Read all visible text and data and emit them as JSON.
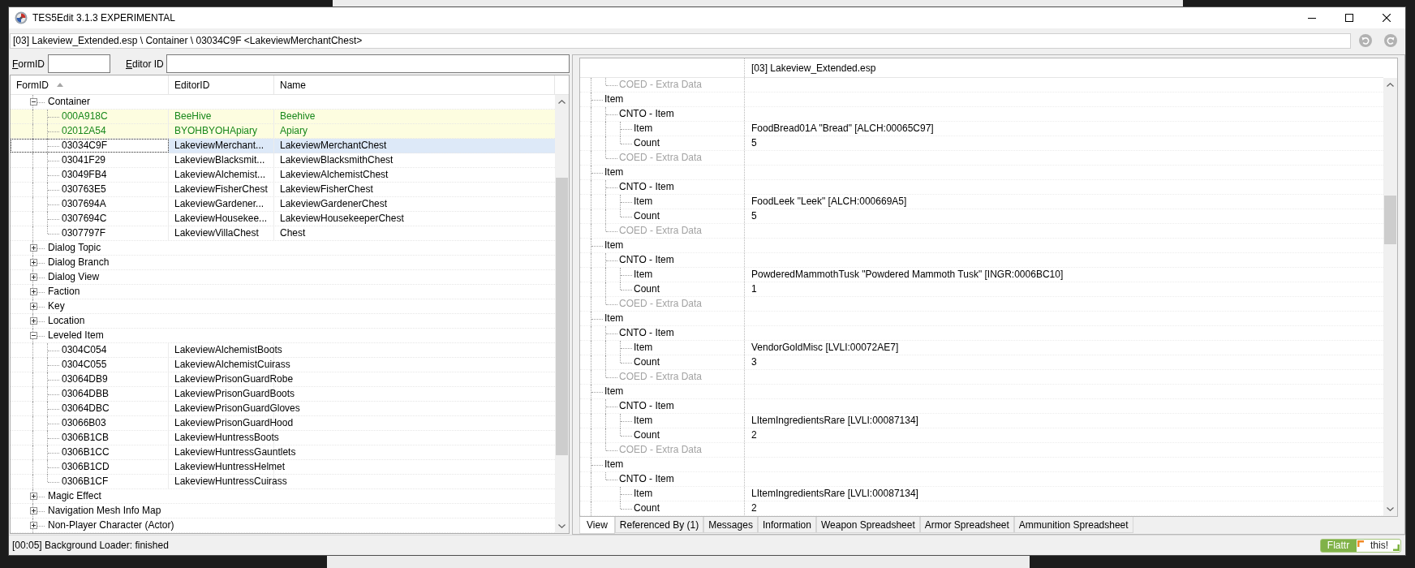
{
  "window": {
    "title": "TES5Edit 3.1.3 EXPERIMENTAL"
  },
  "path_bar": {
    "value": "[03] Lakeview_Extended.esp \\ Container \\ 03034C9F <LakeviewMerchantChest>"
  },
  "filter": {
    "form_id": {
      "label": "FormID"
    },
    "editor_id": {
      "label": "Editor ID"
    }
  },
  "record_tree": {
    "columns": [
      {
        "label": "FormID",
        "sorted": true
      },
      {
        "label": "EditorID",
        "sorted": false
      },
      {
        "label": "Name",
        "sorted": false
      }
    ],
    "groups": [
      {
        "label": "Container",
        "expanded": true,
        "children": [
          {
            "form_id": "000A918C",
            "editor_id": "BeeHive",
            "name": "Beehive",
            "highlighted": true,
            "selected": false
          },
          {
            "form_id": "02012A54",
            "editor_id": "BYOHBYOHApiary",
            "name": "Apiary",
            "highlighted": true,
            "selected": false
          },
          {
            "form_id": "03034C9F",
            "editor_id": "LakeviewMerchant...",
            "name": "LakeviewMerchantChest",
            "highlighted": false,
            "selected": true
          },
          {
            "form_id": "03041F29",
            "editor_id": "LakeviewBlacksmit...",
            "name": "LakeviewBlacksmithChest",
            "highlighted": false,
            "selected": false
          },
          {
            "form_id": "03049FB4",
            "editor_id": "LakeviewAlchemist...",
            "name": "LakeviewAlchemistChest",
            "highlighted": false,
            "selected": false
          },
          {
            "form_id": "030763E5",
            "editor_id": "LakeviewFisherChest",
            "name": "LakeviewFisherChest",
            "highlighted": false,
            "selected": false
          },
          {
            "form_id": "0307694A",
            "editor_id": "LakeviewGardener...",
            "name": "LakeviewGardenerChest",
            "highlighted": false,
            "selected": false
          },
          {
            "form_id": "0307694C",
            "editor_id": "LakeviewHousekee...",
            "name": "LakeviewHousekeeperChest",
            "highlighted": false,
            "selected": false
          },
          {
            "form_id": "0307797F",
            "editor_id": "LakeviewVillaChest",
            "name": "Chest",
            "highlighted": false,
            "selected": false
          }
        ]
      },
      {
        "label": "Dialog Topic",
        "expanded": false
      },
      {
        "label": "Dialog Branch",
        "expanded": false
      },
      {
        "label": "Dialog View",
        "expanded": false
      },
      {
        "label": "Faction",
        "expanded": false
      },
      {
        "label": "Key",
        "expanded": false
      },
      {
        "label": "Location",
        "expanded": false
      },
      {
        "label": "Leveled Item",
        "expanded": true,
        "children": [
          {
            "form_id": "0304C054",
            "editor_id": "LakeviewAlchemistBoots",
            "highlighted": false,
            "selected": false
          },
          {
            "form_id": "0304C055",
            "editor_id": "LakeviewAlchemistCuirass",
            "highlighted": false,
            "selected": false
          },
          {
            "form_id": "03064DB9",
            "editor_id": "LakeviewPrisonGuardRobe",
            "highlighted": false,
            "selected": false
          },
          {
            "form_id": "03064DBB",
            "editor_id": "LakeviewPrisonGuardBoots",
            "highlighted": false,
            "selected": false
          },
          {
            "form_id": "03064DBC",
            "editor_id": "LakeviewPrisonGuardGloves",
            "highlighted": false,
            "selected": false
          },
          {
            "form_id": "03066B03",
            "editor_id": "LakeviewPrisonGuardHood",
            "highlighted": false,
            "selected": false
          },
          {
            "form_id": "0306B1CB",
            "editor_id": "LakeviewHuntressBoots",
            "highlighted": false,
            "selected": false
          },
          {
            "form_id": "0306B1CC",
            "editor_id": "LakeviewHuntressGauntlets",
            "highlighted": false,
            "selected": false
          },
          {
            "form_id": "0306B1CD",
            "editor_id": "LakeviewHuntressHelmet",
            "highlighted": false,
            "selected": false
          },
          {
            "form_id": "0306B1CF",
            "editor_id": "LakeviewHuntressCuirass",
            "highlighted": false,
            "selected": false
          }
        ]
      },
      {
        "label": "Magic Effect",
        "expanded": false
      },
      {
        "label": "Navigation Mesh Info Map",
        "expanded": false
      },
      {
        "label": "Non-Player Character (Actor)",
        "expanded": false
      }
    ]
  },
  "record_view": {
    "header": "[03] Lakeview_Extended.esp",
    "nodes": [
      {
        "children": [
          {
            "label": "COED - Extra Data",
            "greyed": true
          }
        ]
      },
      {
        "label": "Item",
        "greyed": false,
        "children": [
          {
            "label": "CNTO - Item",
            "greyed": false,
            "children": [
              {
                "label": "Item",
                "value": "FoodBread01A \"Bread\" [ALCH:00065C97]",
                "greyed": false
              },
              {
                "label": "Count",
                "value": "5",
                "greyed": false
              }
            ]
          },
          {
            "label": "COED - Extra Data",
            "greyed": true
          }
        ]
      },
      {
        "label": "Item",
        "greyed": false,
        "children": [
          {
            "label": "CNTO - Item",
            "greyed": false,
            "children": [
              {
                "label": "Item",
                "value": "FoodLeek \"Leek\" [ALCH:000669A5]",
                "greyed": false
              },
              {
                "label": "Count",
                "value": "5",
                "greyed": false
              }
            ]
          },
          {
            "label": "COED - Extra Data",
            "greyed": true
          }
        ]
      },
      {
        "label": "Item",
        "greyed": false,
        "children": [
          {
            "label": "CNTO - Item",
            "greyed": false,
            "children": [
              {
                "label": "Item",
                "value": "PowderedMammothTusk \"Powdered Mammoth Tusk\" [INGR:0006BC10]",
                "greyed": false
              },
              {
                "label": "Count",
                "value": "1",
                "greyed": false
              }
            ]
          },
          {
            "label": "COED - Extra Data",
            "greyed": true
          }
        ]
      },
      {
        "label": "Item",
        "greyed": false,
        "children": [
          {
            "label": "CNTO - Item",
            "greyed": false,
            "children": [
              {
                "label": "Item",
                "value": "VendorGoldMisc [LVLI:00072AE7]",
                "greyed": false
              },
              {
                "label": "Count",
                "value": "3",
                "greyed": false
              }
            ]
          },
          {
            "label": "COED - Extra Data",
            "greyed": true
          }
        ]
      },
      {
        "label": "Item",
        "greyed": false,
        "children": [
          {
            "label": "CNTO - Item",
            "greyed": false,
            "children": [
              {
                "label": "Item",
                "value": "LItemIngredientsRare [LVLI:00087134]",
                "greyed": false
              },
              {
                "label": "Count",
                "value": "2",
                "greyed": false
              }
            ]
          },
          {
            "label": "COED - Extra Data",
            "greyed": true
          }
        ]
      },
      {
        "label": "Item",
        "greyed": false,
        "children": [
          {
            "label": "CNTO - Item",
            "greyed": false,
            "children": [
              {
                "label": "Item",
                "value": "LItemIngredientsRare [LVLI:00087134]",
                "greyed": false
              },
              {
                "label": "Count",
                "value": "2",
                "greyed": false
              }
            ]
          }
        ]
      }
    ]
  },
  "view_tabs": [
    {
      "label": "View",
      "selected": true
    },
    {
      "label": "Referenced By (1)",
      "selected": false
    },
    {
      "label": "Messages",
      "selected": false
    },
    {
      "label": "Information",
      "selected": false
    },
    {
      "label": "Weapon Spreadsheet",
      "selected": false
    },
    {
      "label": "Armor Spreadsheet",
      "selected": false
    },
    {
      "label": "Ammunition Spreadsheet",
      "selected": false
    }
  ],
  "status_bar": {
    "text": "[00:05] Background Loader: finished",
    "flattr": {
      "label": "Flattr",
      "suffix": "this!"
    }
  }
}
